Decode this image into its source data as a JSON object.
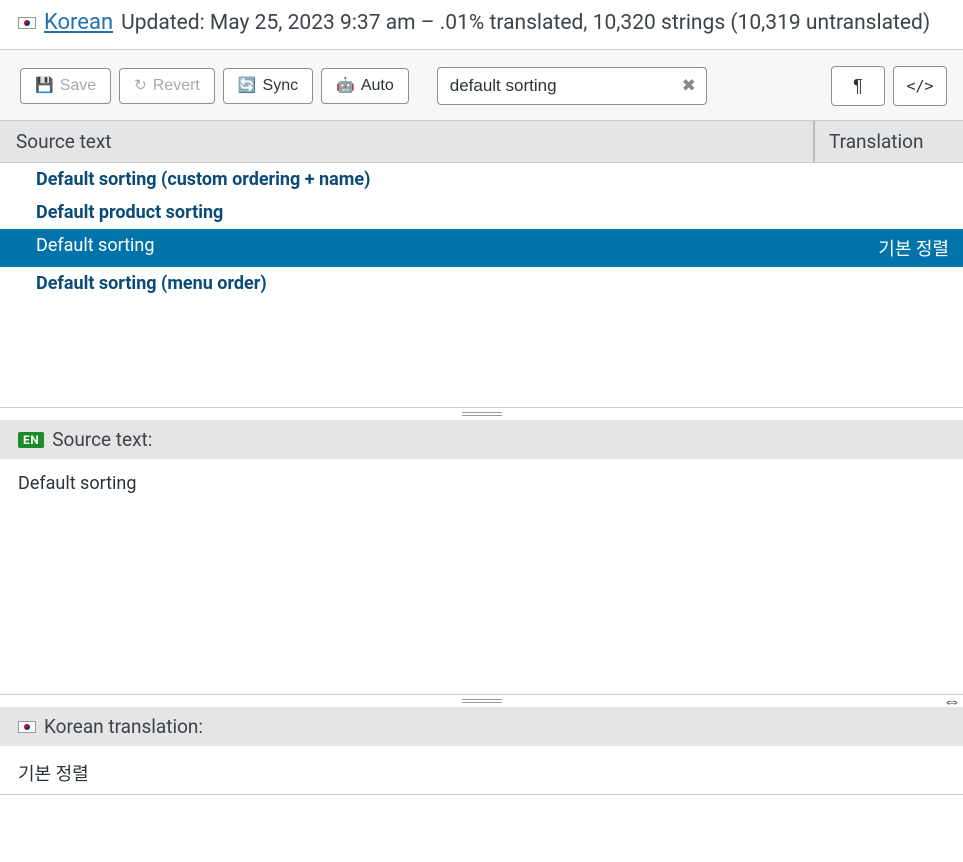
{
  "header": {
    "language": "Korean",
    "meta": "Updated: May 25, 2023 9:37 am – .01% translated, 10,320 strings (10,319 untranslated)"
  },
  "toolbar": {
    "save": "Save",
    "revert": "Revert",
    "sync": "Sync",
    "auto": "Auto",
    "search_value": "default sorting"
  },
  "grid": {
    "col_source": "Source text",
    "col_translation": "Translation",
    "rows": [
      {
        "source": "Default sorting (custom ordering + name)",
        "translation": ""
      },
      {
        "source": "Default product sorting",
        "translation": ""
      },
      {
        "source": "Default sorting",
        "translation": "기본 정렬"
      },
      {
        "source": "Default sorting (menu order)",
        "translation": ""
      }
    ],
    "selected_index": 2
  },
  "source_panel": {
    "badge": "EN",
    "label": "Source text:",
    "value": "Default sorting"
  },
  "trans_panel": {
    "label": "Korean translation:",
    "value": "기본 정렬"
  }
}
